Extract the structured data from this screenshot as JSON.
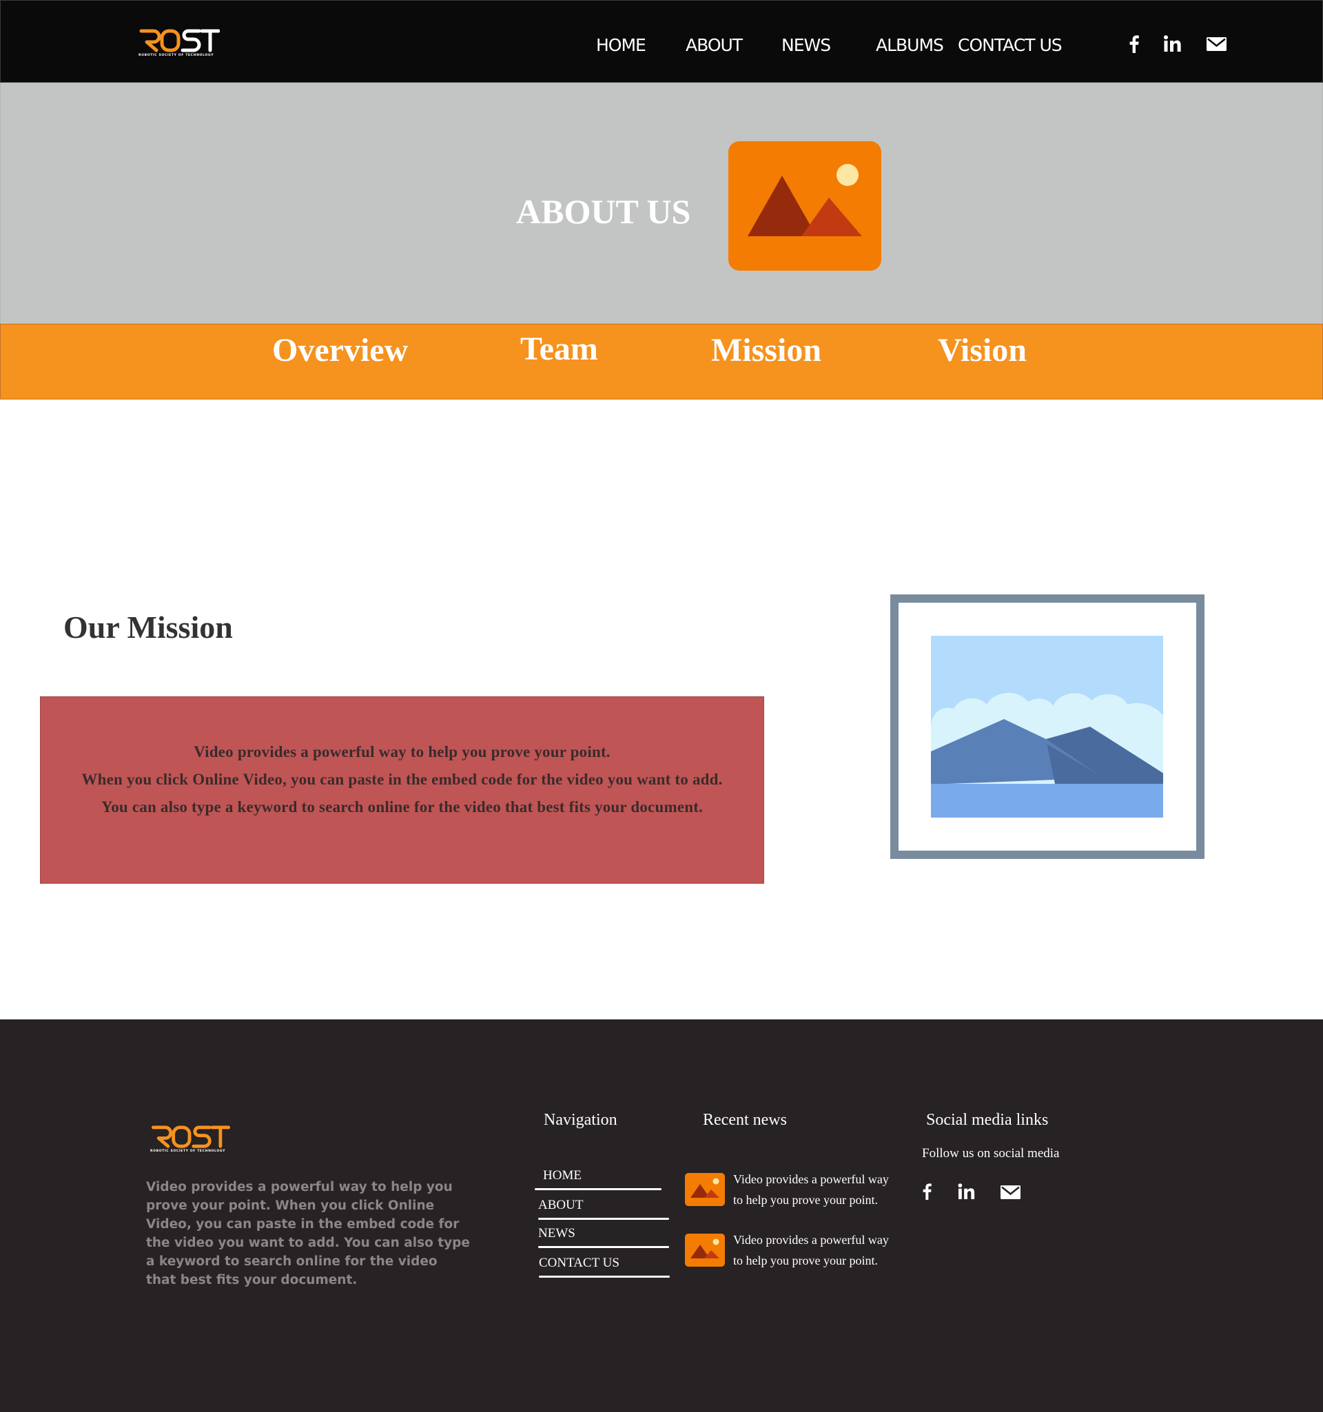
{
  "brand": {
    "logo_text": "ROST",
    "tagline": "ROBOTIC SOCIETY OF TECHNOLOGY",
    "colors": {
      "orange": "#f6921e",
      "dark": "#0a0a0a",
      "hero_gray": "#c3c5c4",
      "mission_red": "#c05555",
      "footer_bg": "#272223"
    }
  },
  "header": {
    "nav": [
      {
        "label": "HOME"
      },
      {
        "label": "ABOUT"
      },
      {
        "label": "NEWS"
      },
      {
        "label": "ALBUMS"
      },
      {
        "label": "CONTACT US"
      }
    ],
    "social_icons": [
      "facebook-icon",
      "linkedin-icon",
      "mail-icon"
    ]
  },
  "hero": {
    "title": "ABOUT US",
    "image_icon": "mountain-landscape-icon"
  },
  "tabs": [
    {
      "label": "Overview"
    },
    {
      "label": "Team"
    },
    {
      "label": "Mission"
    },
    {
      "label": "Vision"
    }
  ],
  "mission": {
    "title": "Our Mission",
    "lines": [
      "Video provides a powerful way to help you prove your point.",
      "When you click Online Video, you can paste in the embed code for the video you want to add.",
      "You can also type a keyword to search online for the video that best fits your document."
    ],
    "image_icon": "framed-landscape-icon"
  },
  "footer": {
    "description": "Video provides a powerful way to help you prove your point. When you click Online Video, you can paste in the embed code for the video you want to add. You can also type a keyword to search online for the video that best fits your document.",
    "navigation": {
      "heading": "Navigation",
      "links": [
        {
          "label": "HOME"
        },
        {
          "label": "ABOUT"
        },
        {
          "label": "NEWS"
        },
        {
          "label": "CONTACT US"
        }
      ]
    },
    "recent_news": {
      "heading": "Recent news",
      "items": [
        {
          "text": "Video provides a powerful way to help you prove your point."
        },
        {
          "text": "Video provides a powerful way to help you prove your point."
        }
      ]
    },
    "social": {
      "heading": "Social media links",
      "follow_text": "Follow us on social media",
      "icons": [
        "facebook-icon",
        "linkedin-icon",
        "mail-icon"
      ]
    }
  }
}
